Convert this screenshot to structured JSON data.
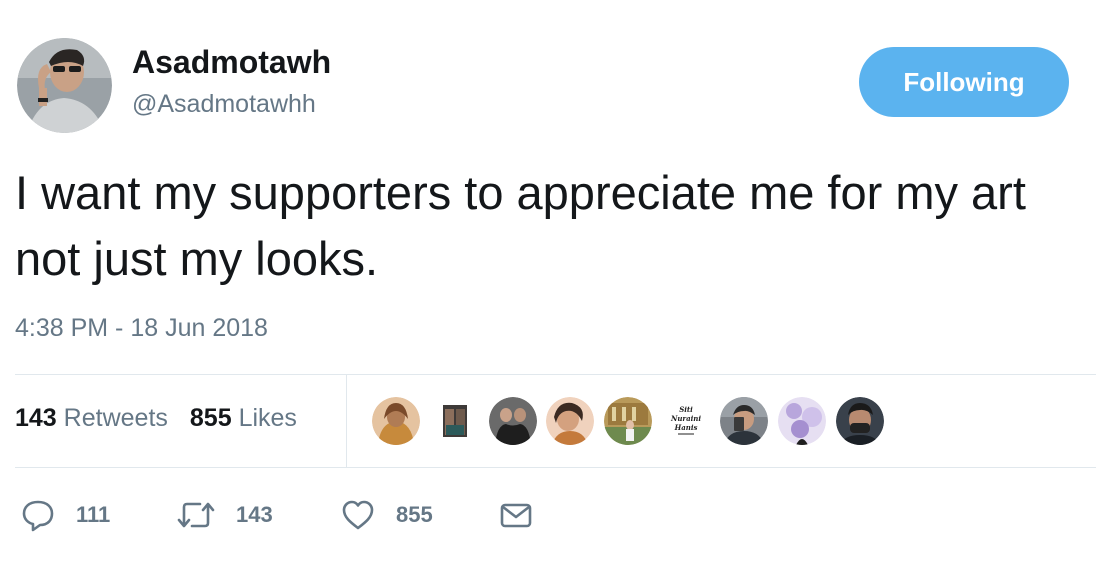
{
  "user": {
    "display_name": "Asadmotawh",
    "handle": "@Asadmotawhh"
  },
  "follow_button": {
    "label": "Following"
  },
  "tweet": {
    "text": "I want my supporters to appreciate me for my art not just my looks.",
    "timestamp": "4:38 PM - 18 Jun 2018"
  },
  "stats": {
    "retweets_count": "143",
    "retweets_label": "Retweets",
    "likes_count": "855",
    "likes_label": "Likes"
  },
  "likers": [
    {
      "name": "liker-avatar-1",
      "bg": "#d9a06b"
    },
    {
      "name": "liker-avatar-2",
      "bg": "#3e3a38"
    },
    {
      "name": "liker-avatar-3",
      "bg": "#4a4a4a"
    },
    {
      "name": "liker-avatar-4",
      "bg": "#e8b89b"
    },
    {
      "name": "liker-avatar-5",
      "bg": "#8aa078"
    },
    {
      "name": "liker-avatar-6",
      "bg": "#f2f2f2",
      "text": "Siti Nuraini Hanis"
    },
    {
      "name": "liker-avatar-7",
      "bg": "#5a5e66"
    },
    {
      "name": "liker-avatar-8",
      "bg": "#c6b8e0"
    },
    {
      "name": "liker-avatar-9",
      "bg": "#2b3038"
    }
  ],
  "actions": {
    "reply_count": "111",
    "retweet_count": "143",
    "like_count": "855"
  },
  "colors": {
    "accent": "#5bb3ef",
    "secondary_text": "#657786",
    "primary_text": "#14171a",
    "divider": "#e1e8ed"
  },
  "icons": [
    "reply-icon",
    "retweet-icon",
    "heart-icon",
    "direct-message-icon"
  ]
}
